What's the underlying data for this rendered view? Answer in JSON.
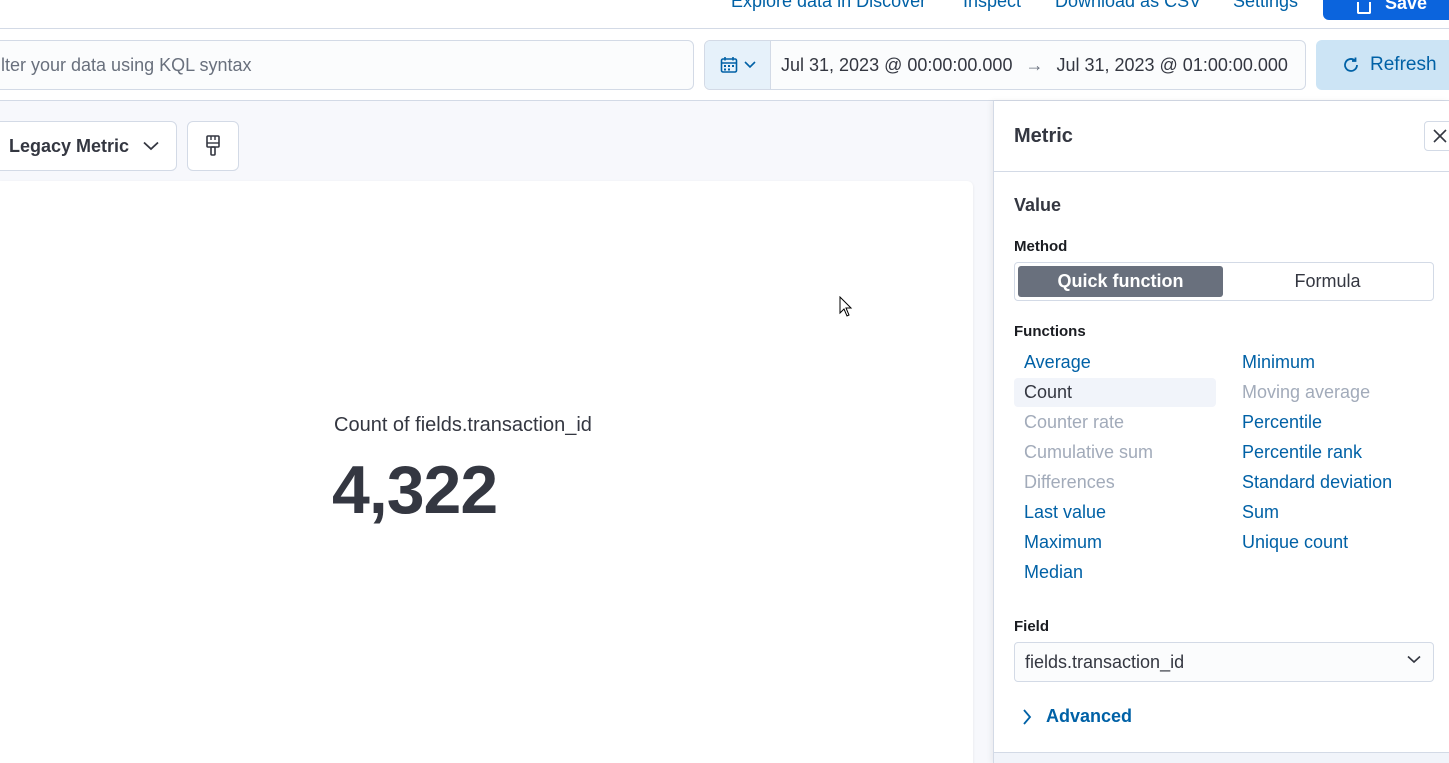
{
  "topbar": {
    "links": [
      "Explore data in Discover",
      "Inspect",
      "Download as CSV",
      "Settings"
    ],
    "save_label": "Save"
  },
  "query": {
    "placeholder": "lter your data using KQL syntax",
    "start_date": "Jul 31, 2023 @ 00:00:00.000",
    "end_date": "Jul 31, 2023 @ 01:00:00.000",
    "refresh_label": "Refresh"
  },
  "chart_type": {
    "label": "Legacy Metric"
  },
  "metric": {
    "label": "Count of fields.transaction_id",
    "value": "4,322"
  },
  "panel": {
    "title": "Metric",
    "section": "Value",
    "method_label": "Method",
    "methods": [
      "Quick function",
      "Formula"
    ],
    "functions_label": "Functions",
    "functions_left": [
      "Average",
      "Count",
      "Counter rate",
      "Cumulative sum",
      "Differences",
      "Last value",
      "Maximum",
      "Median"
    ],
    "functions_right": [
      "Minimum",
      "Moving average",
      "Percentile",
      "Percentile rank",
      "Standard deviation",
      "Sum",
      "Unique count"
    ],
    "field_label": "Field",
    "field_value": "fields.transaction_id",
    "advanced_label": "Advanced"
  },
  "colors": {
    "link": "#0061a6",
    "primary": "#0b64dd",
    "disabled": "#a2abba",
    "active_toggle": "#69707d"
  }
}
